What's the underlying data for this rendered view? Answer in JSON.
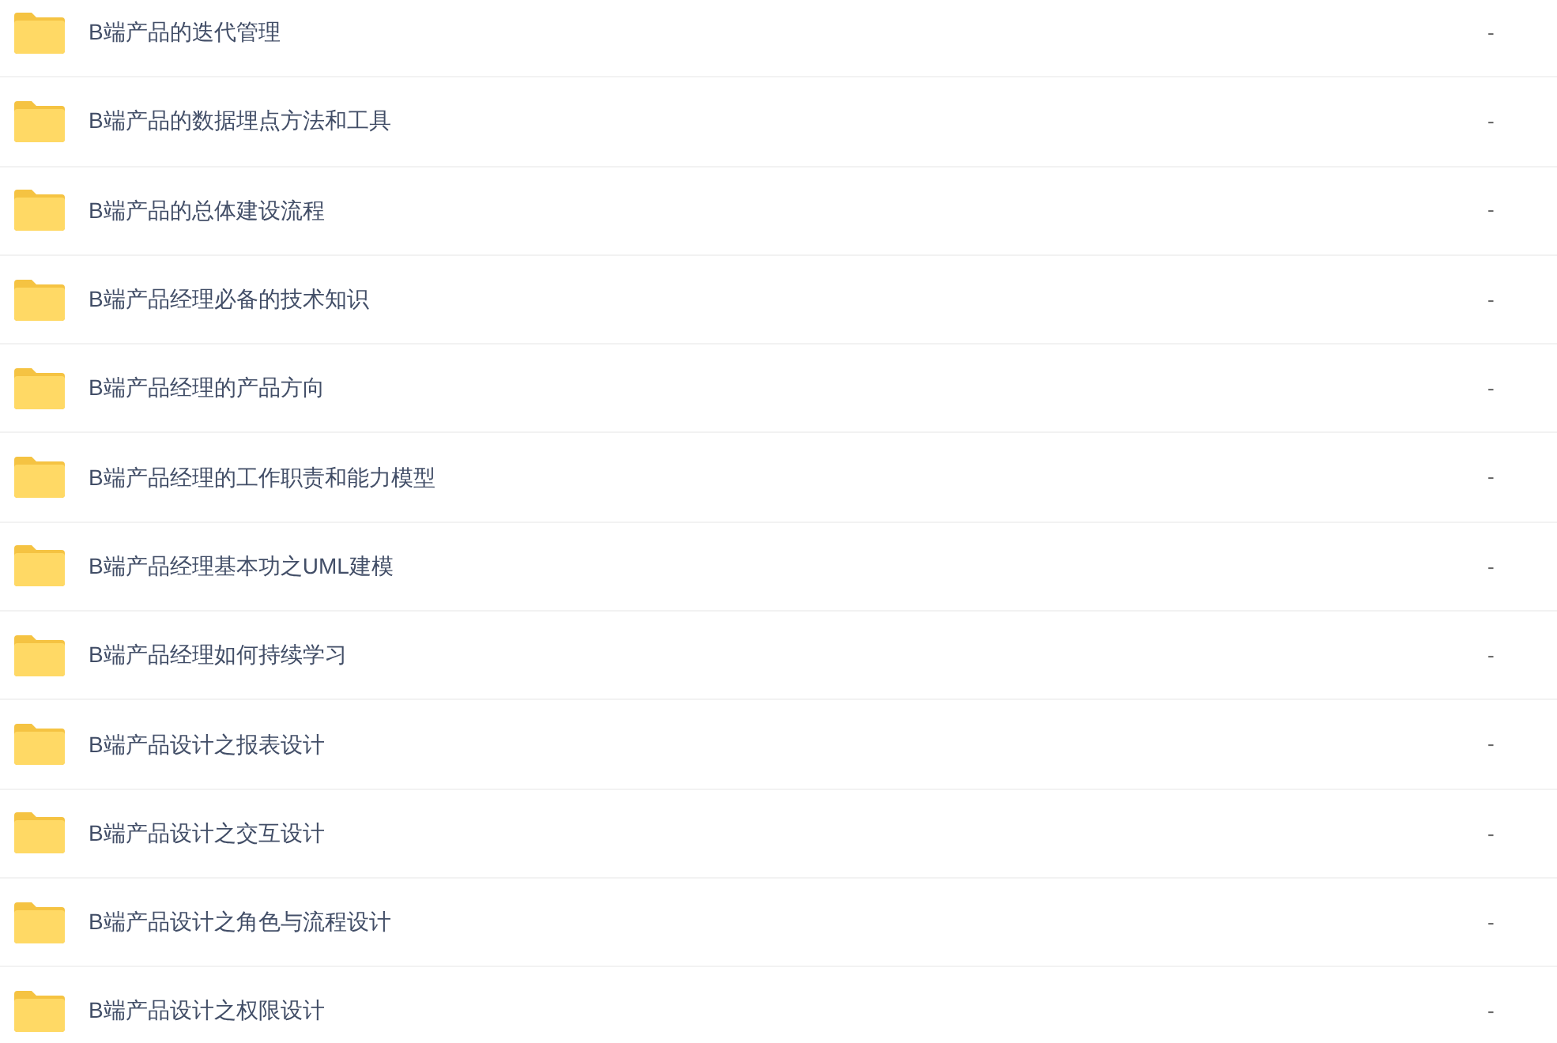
{
  "files": [
    {
      "name": "B端产品的迭代管理",
      "size": "-"
    },
    {
      "name": "B端产品的数据埋点方法和工具",
      "size": "-"
    },
    {
      "name": "B端产品的总体建设流程",
      "size": "-"
    },
    {
      "name": "B端产品经理必备的技术知识",
      "size": "-"
    },
    {
      "name": "B端产品经理的产品方向",
      "size": "-"
    },
    {
      "name": "B端产品经理的工作职责和能力模型",
      "size": "-"
    },
    {
      "name": "B端产品经理基本功之UML建模",
      "size": "-"
    },
    {
      "name": "B端产品经理如何持续学习",
      "size": "-"
    },
    {
      "name": "B端产品设计之报表设计",
      "size": "-"
    },
    {
      "name": "B端产品设计之交互设计",
      "size": "-"
    },
    {
      "name": "B端产品设计之角色与流程设计",
      "size": "-"
    },
    {
      "name": "B端产品设计之权限设计",
      "size": "-"
    }
  ]
}
